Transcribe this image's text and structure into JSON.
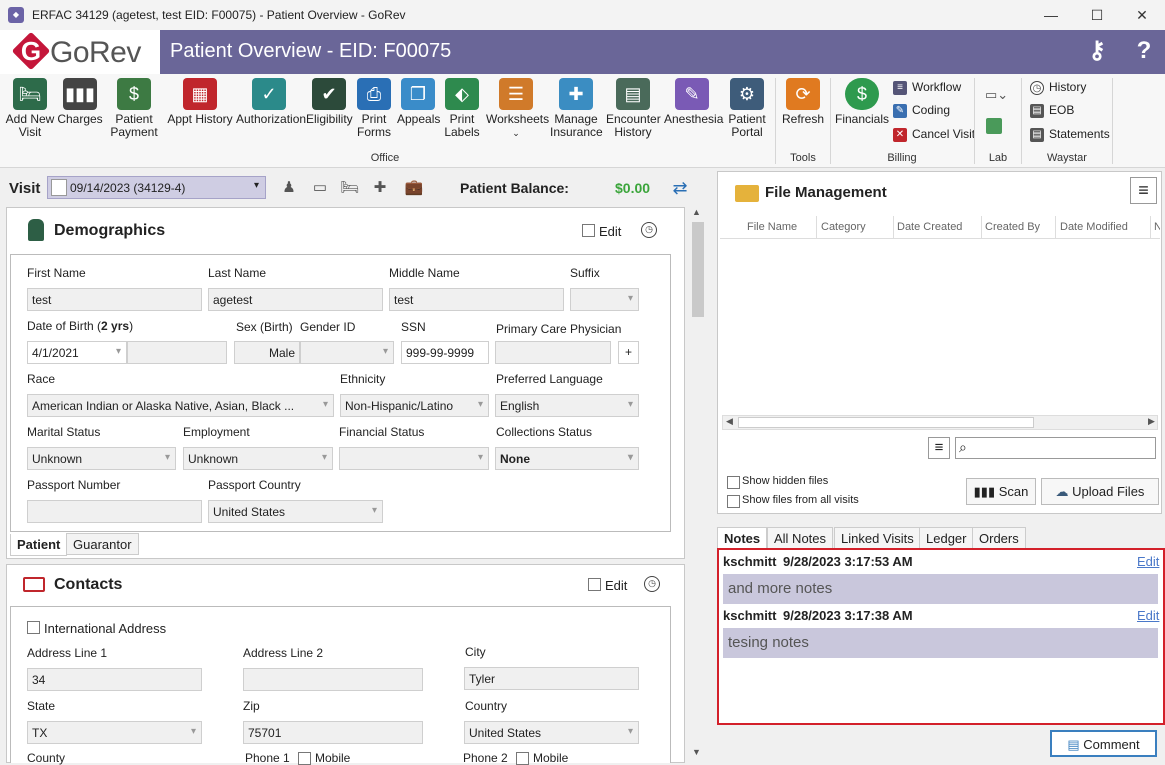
{
  "window": {
    "title": "ERFAC 34129 (agetest, test EID: F00075) - Patient Overview - GoRev",
    "app_icon": "GoRev",
    "minimize": "—",
    "maximize": "☐",
    "close": "✕"
  },
  "header": {
    "logo": "GoRev",
    "logo_letter": "G",
    "page_title": "Patient Overview - EID: F00075",
    "icon_user": "user-key-icon",
    "icon_help": "?"
  },
  "ribbon": {
    "office": [
      {
        "label": "Add New\nVisit",
        "icon": "bed-plus-icon"
      },
      {
        "label": "Charges",
        "icon": "barcode-icon"
      },
      {
        "label": "Patient\nPayment",
        "icon": "payment-icon"
      },
      {
        "label": "Appt History",
        "icon": "calendar-icon"
      },
      {
        "label": "Authorization",
        "icon": "shield-check-icon"
      },
      {
        "label": "Eligibility",
        "icon": "user-check-icon"
      },
      {
        "label": "Print\nForms",
        "icon": "printer-icon"
      },
      {
        "label": "Appeals",
        "icon": "copy-icon"
      },
      {
        "label": "Print\nLabels",
        "icon": "tag-icon"
      },
      {
        "label": "Worksheets",
        "icon": "worksheets-icon"
      },
      {
        "label": "Manage\nInsurance",
        "icon": "insurance-icon"
      },
      {
        "label": "Encounter\nHistory",
        "icon": "encounter-icon"
      },
      {
        "label": "Anesthesia",
        "icon": "syringe-icon"
      },
      {
        "label": "Patient\nPortal",
        "icon": "globe-icon"
      }
    ],
    "office_group": "Office",
    "tools": {
      "refresh": "Refresh",
      "group": "Tools"
    },
    "billing": {
      "financials": "Financials",
      "workflow": "Workflow",
      "coding": "Coding",
      "cancel_visit": "Cancel Visit",
      "group": "Billing"
    },
    "lab": {
      "group": "Lab"
    },
    "waystar": {
      "history": "History",
      "eob": "EOB",
      "statements": "Statements",
      "group": "Waystar"
    }
  },
  "visit": {
    "label": "Visit",
    "selected": "09/14/2023 (34129-4)",
    "balance_label": "Patient Balance:",
    "balance_value": "$0.00"
  },
  "demographics": {
    "title": "Demographics",
    "edit": "Edit",
    "first_name_label": "First Name",
    "first_name": "test",
    "last_name_label": "Last Name",
    "last_name": "agetest",
    "middle_name_label": "Middle Name",
    "middle_name": "test",
    "suffix_label": "Suffix",
    "dob_label": "Date of Birth (",
    "dob_age": "2 yrs",
    ")": ")",
    "dob": "4/1/2021",
    "sex_label": "Sex (Birth)",
    "sex": "Male",
    "gender_label": "Gender ID",
    "ssn_label": "SSN",
    "ssn": "999-99-9999",
    "pcp_label": "Primary Care Physician",
    "pcp_add": "+",
    "race_label": "Race",
    "race": "American Indian or Alaska Native, Asian, Black ...",
    "ethnicity_label": "Ethnicity",
    "ethnicity": "Non-Hispanic/Latino",
    "language_label": "Preferred Language",
    "language": "English",
    "marital_label": "Marital Status",
    "marital": "Unknown",
    "employment_label": "Employment",
    "employment": "Unknown",
    "financial_label": "Financial Status",
    "collections_label": "Collections Status",
    "collections": "None",
    "passport_label": "Passport Number",
    "passport_country_label": "Passport Country",
    "passport_country": "United States",
    "tabs": [
      "Patient",
      "Guarantor"
    ]
  },
  "contacts": {
    "title": "Contacts",
    "edit": "Edit",
    "intl_label": "International Address",
    "addr1_label": "Address Line 1",
    "addr1": "34",
    "addr2_label": "Address Line 2",
    "city_label": "City",
    "city": "Tyler",
    "state_label": "State",
    "state": "TX",
    "zip_label": "Zip",
    "zip": "75701",
    "country_label": "Country",
    "country": "United States",
    "county_label": "County",
    "phone1_label": "Phone 1",
    "mobile1": "Mobile",
    "phone2_label": "Phone 2",
    "mobile2": "Mobile"
  },
  "files": {
    "title": "File Management",
    "columns": [
      "File Name",
      "Category",
      "Date Created",
      "Created By",
      "Date Modified",
      "N"
    ],
    "show_hidden": "Show hidden files",
    "show_all_visits": "Show files from all visits",
    "scan": "Scan",
    "upload": "Upload Files"
  },
  "notes": {
    "tabs": [
      "Notes",
      "All Notes",
      "Linked Visits",
      "Ledger",
      "Orders"
    ],
    "items": [
      {
        "user": "kschmitt",
        "date": "9/28/2023 3:17:53 AM",
        "edit": "Edit",
        "text": "and more notes"
      },
      {
        "user": "kschmitt",
        "date": "9/28/2023 3:17:38 AM",
        "edit": "Edit",
        "text": "tesing notes"
      }
    ],
    "comment": "Comment"
  },
  "colors": {
    "header": "#6a6698",
    "accent_red": "#d3202a",
    "balance": "#3ba53b",
    "note_bg": "#c9c7dc",
    "link": "#4a78c9"
  }
}
